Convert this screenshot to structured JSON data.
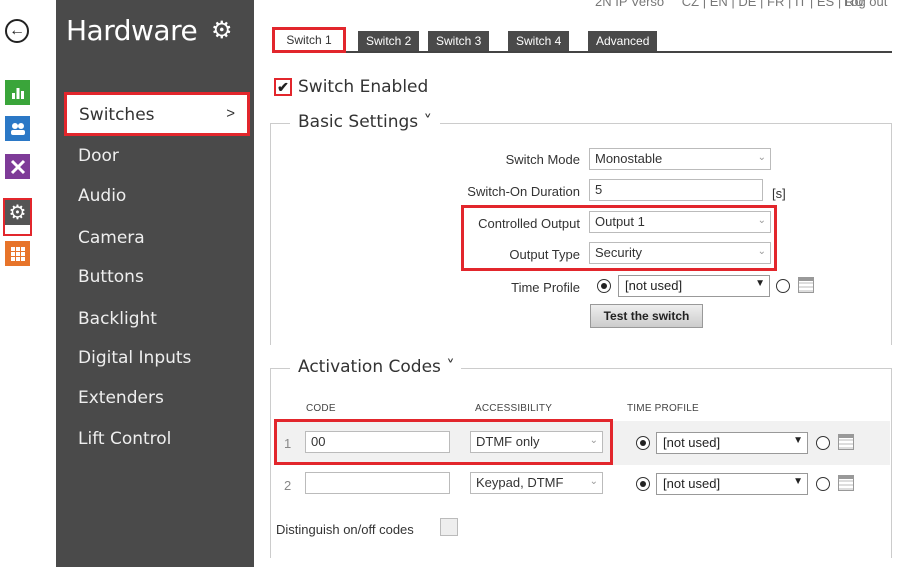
{
  "top": {
    "links": [
      "2N IP Verso",
      "CZ | EN | DE | FR | IT | ES | RU"
    ],
    "logout": "Log out"
  },
  "sidebar": {
    "title": "Hardware",
    "items": [
      {
        "label": "Switches",
        "active": true
      },
      {
        "label": "Door"
      },
      {
        "label": "Audio"
      },
      {
        "label": "Camera"
      },
      {
        "label": "Buttons"
      },
      {
        "label": "Backlight"
      },
      {
        "label": "Digital Inputs"
      },
      {
        "label": "Extenders"
      },
      {
        "label": "Lift Control"
      }
    ],
    "active_chevron": ">"
  },
  "tabs": [
    "Switch 1",
    "Switch 2",
    "Switch 3",
    "Switch 4",
    "Advanced"
  ],
  "switch_enabled": {
    "label": "Switch Enabled",
    "checked": true
  },
  "basic": {
    "legend": "Basic Settings ˅",
    "switch_mode": {
      "label": "Switch Mode",
      "value": "Monostable"
    },
    "on_duration": {
      "label": "Switch-On Duration",
      "value": "5",
      "unit": "[s]"
    },
    "controlled_output": {
      "label": "Controlled Output",
      "value": "Output 1"
    },
    "output_type": {
      "label": "Output Type",
      "value": "Security"
    },
    "time_profile": {
      "label": "Time Profile",
      "value": "[not used]"
    },
    "test_button": "Test the switch"
  },
  "codes": {
    "legend": "Activation Codes ˅",
    "headers": [
      "CODE",
      "ACCESSIBILITY",
      "TIME PROFILE"
    ],
    "rows": [
      {
        "num": "1",
        "code": "00",
        "access": "DTMF only",
        "profile": "[not used]"
      },
      {
        "num": "2",
        "code": "",
        "access": "Keypad, DTMF",
        "profile": "[not used]"
      }
    ],
    "distinguish_label": "Distinguish on/off codes"
  },
  "colors": {
    "accent_red": "#e2262c",
    "sidebar_bg": "#4a4a4a"
  }
}
